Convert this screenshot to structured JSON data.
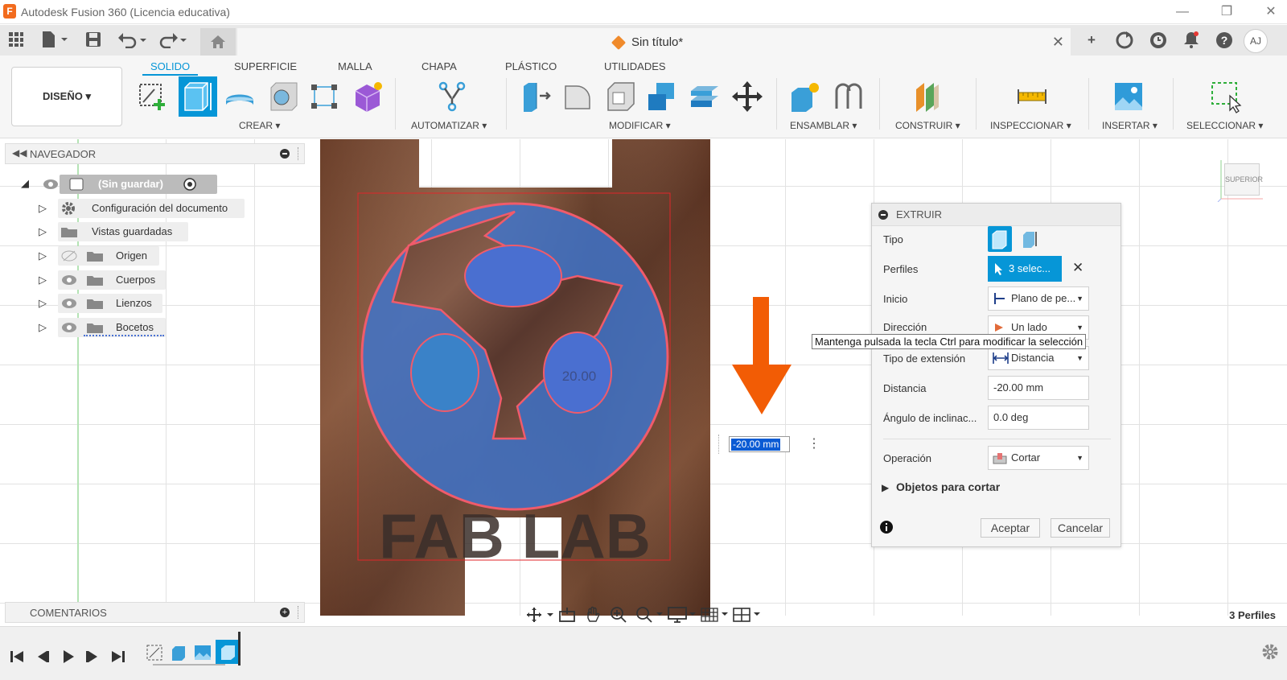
{
  "window": {
    "title": "Autodesk Fusion 360 (Licencia educativa)",
    "logo_letter": "F"
  },
  "tab": {
    "title": "Sin título*",
    "user_initials": "AJ"
  },
  "ribbon": {
    "workspace": "DISEÑO",
    "tabs": [
      "SOLIDO",
      "SUPERFICIE",
      "MALLA",
      "CHAPA",
      "PLÁSTICO",
      "UTILIDADES"
    ],
    "groups": {
      "crear": "CREAR",
      "automatizar": "AUTOMATIZAR",
      "modificar": "MODIFICAR",
      "ensamblar": "ENSAMBLAR",
      "construir": "CONSTRUIR",
      "inspeccionar": "INSPECCIONAR",
      "insertar": "INSERTAR",
      "seleccionar": "SELECCIONAR"
    }
  },
  "navigator": {
    "title": "NAVEGADOR",
    "root": "(Sin guardar)",
    "items": [
      {
        "label": "Configuración del documento",
        "icon": "gear-icon"
      },
      {
        "label": "Vistas guardadas",
        "icon": "folder-icon"
      },
      {
        "label": "Origen",
        "icon": "folder-icon"
      },
      {
        "label": "Cuerpos",
        "icon": "folder-icon"
      },
      {
        "label": "Lienzos",
        "icon": "folder-icon"
      },
      {
        "label": "Bocetos",
        "icon": "folder-icon"
      }
    ]
  },
  "comments": {
    "title": "COMENTARIOS"
  },
  "canvas": {
    "logo_text": "FAB LAB",
    "dimension_label": "20.00",
    "dimension_input": "-20.00 mm",
    "viewcube_label": "SUPERIOR",
    "accent_arrow": "#f25c05"
  },
  "extrude": {
    "title": "EXTRUIR",
    "tipo_label": "Tipo",
    "perfiles_label": "Perfiles",
    "perfiles_value": "3 selec...",
    "inicio_label": "Inicio",
    "inicio_value": "Plano de pe...",
    "direccion_label": "Dirección",
    "direccion_value": "Un lado",
    "tipo_ext_label": "Tipo de extensión",
    "tipo_ext_value": "Distancia",
    "distancia_label": "Distancia",
    "distancia_value": "-20.00 mm",
    "angulo_label": "Ángulo de inclinac...",
    "angulo_value": "0.0 deg",
    "operacion_label": "Operación",
    "operacion_value": "Cortar",
    "objetos_label": "Objetos para cortar",
    "accept": "Aceptar",
    "cancel": "Cancelar",
    "accent": "#0696d7"
  },
  "tooltip": "Mantenga pulsada la tecla Ctrl para modificar la selección",
  "status": {
    "profiles": "3 Perfiles"
  }
}
